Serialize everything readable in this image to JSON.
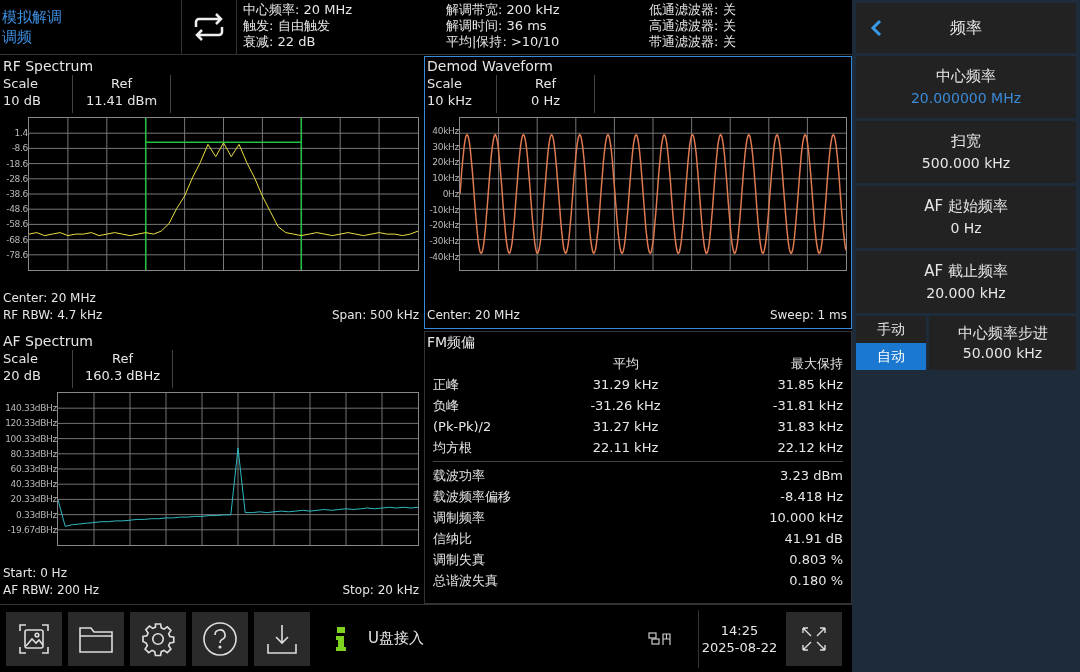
{
  "mode": {
    "title": "模拟解调",
    "subtitle": "调频"
  },
  "status": {
    "columns": [
      [
        "中心频率: 20 MHz",
        "触发: 自由触发",
        "衰减: 22 dB"
      ],
      [
        "解调带宽: 200 kHz",
        "解调时间: 36 ms",
        "平均|保持: >10/10"
      ],
      [
        "低通滤波器: 关",
        "高通滤波器: 关",
        "带通滤波器: 关"
      ]
    ]
  },
  "rf_spectrum": {
    "title": "RF Spectrum",
    "scale_label": "Scale",
    "scale": "10 dB",
    "ref_label": "Ref",
    "ref": "11.41 dBm",
    "selected": false,
    "footer_left": [
      "Center: 20 MHz",
      "RF RBW: 4.7 kHz"
    ],
    "footer_right": "Span: 500 kHz",
    "chart_data": {
      "type": "line",
      "grid": true,
      "ylim": [
        -88.6,
        11.4
      ],
      "ref_lines": [
        {
          "axis": "y",
          "value": -4.6,
          "color": "#22c040"
        }
      ],
      "yticks": [
        1.4,
        -8.6,
        -18.6,
        -28.6,
        -38.6,
        -48.6,
        -58.6,
        -68.6,
        -78.6
      ],
      "categories": [
        null,
        null,
        null,
        null,
        null,
        null,
        null,
        null,
        null,
        null,
        null,
        null,
        null,
        null,
        null,
        null,
        null,
        null,
        null,
        null,
        null,
        null,
        null,
        null,
        null,
        null,
        null,
        null,
        null,
        null,
        null,
        null,
        null,
        null,
        null,
        null,
        null,
        null,
        null,
        null,
        null,
        null,
        null,
        null,
        null,
        null,
        null,
        null,
        null,
        null,
        null
      ],
      "series": [
        {
          "color": "#e8e040",
          "values": [
            -65,
            -64,
            -66,
            -65,
            -64,
            -66,
            -65,
            -65,
            -64,
            -66,
            -65,
            -64,
            -65,
            -66,
            -65,
            -64,
            -65,
            -63,
            -58,
            -48,
            -40,
            -28,
            -18,
            -6,
            -14,
            -5,
            -14,
            -6,
            -18,
            -28,
            -40,
            -50,
            -60,
            -64,
            -65,
            -66,
            -65,
            -64,
            -65,
            -66,
            -65,
            -64,
            -65,
            -66,
            -65,
            -64,
            -65,
            -65,
            -66,
            -65,
            -63
          ]
        }
      ]
    }
  },
  "demod_waveform": {
    "title": "Demod Waveform",
    "scale_label": "Scale",
    "scale": "10 kHz",
    "ref_label": "Ref",
    "ref": "0 Hz",
    "selected": true,
    "y_labels": [
      "40kHz",
      "30kHz",
      "20kHz",
      "10kHz",
      "0Hz",
      "-10kHz",
      "-20kHz",
      "-30kHz",
      "-40kHz"
    ],
    "footer_left": [
      "Center: 20 MHz"
    ],
    "footer_right": "Sweep: 1 ms"
  },
  "af_spectrum": {
    "title": "AF Spectrum",
    "scale_label": "Scale",
    "scale": "20 dB",
    "ref_label": "Ref",
    "ref": "160.3 dBHz",
    "selected": false,
    "footer_left": [
      "Start: 0 Hz",
      "AF RBW: 200 Hz"
    ],
    "footer_right": "Stop: 20 kHz",
    "chart_data": {
      "type": "line",
      "grid": true,
      "ylim": [
        -39.67,
        160.33
      ],
      "yticks": [
        {
          "value": 140.33,
          "label": "140.33dBHz"
        },
        {
          "value": 120.33,
          "label": "120.33dBHz"
        },
        {
          "value": 100.33,
          "label": "100.33dBHz"
        },
        {
          "value": 80.33,
          "label": "80.33dBHz"
        },
        {
          "value": 60.33,
          "label": "60.33dBHz"
        },
        {
          "value": 40.33,
          "label": "40.33dBHz"
        },
        {
          "value": 20.33,
          "label": "20.33dBHz"
        },
        {
          "value": 0.33,
          "label": "0.33dBHz"
        },
        {
          "value": -19.67,
          "label": "-19.67dBHz"
        }
      ],
      "categories": [
        null,
        null,
        null,
        null,
        null,
        null,
        null,
        null,
        null,
        null,
        null,
        null,
        null,
        null,
        null,
        null,
        null,
        null,
        null,
        null,
        null,
        null,
        null,
        null,
        null,
        null,
        null,
        null,
        null,
        null,
        null,
        null,
        null,
        null,
        null,
        null,
        null,
        null,
        null,
        null,
        null,
        null,
        null,
        null,
        null,
        null,
        null,
        null,
        null,
        null,
        null
      ],
      "series": [
        {
          "color": "#30c0c8",
          "values": [
            20,
            -15,
            -13,
            -12,
            -11,
            -10,
            -9,
            -9,
            -8,
            -8,
            -7,
            -6,
            -6,
            -5,
            -5,
            -4,
            -4,
            -3,
            -3,
            -2,
            -2,
            -1,
            -1,
            0,
            0,
            88,
            3,
            3,
            4,
            3,
            4,
            5,
            4,
            5,
            6,
            5,
            6,
            7,
            6,
            7,
            8,
            7,
            8,
            9,
            8,
            9,
            10,
            9,
            10,
            9,
            10
          ]
        }
      ]
    }
  },
  "fm_deviation": {
    "title": "FM频偏",
    "headers": [
      "平均",
      "最大保持"
    ],
    "rows": [
      {
        "label": "正峰",
        "average": "31.29 kHz",
        "max_hold": "31.85 kHz"
      },
      {
        "label": "负峰",
        "average": "-31.26 kHz",
        "max_hold": "-31.81 kHz"
      },
      {
        "label": "(Pk-Pk)/2",
        "average": "31.27 kHz",
        "max_hold": "31.83 kHz"
      },
      {
        "label": "均方根",
        "average": "22.11 kHz",
        "max_hold": "22.12 kHz"
      }
    ],
    "metrics": [
      {
        "label": "载波功率",
        "value": "3.23 dBm"
      },
      {
        "label": "载波频率偏移",
        "value": "-8.418 Hz"
      },
      {
        "label": "调制频率",
        "value": "10.000 kHz"
      },
      {
        "label": "信纳比",
        "value": "41.91 dB"
      },
      {
        "label": "调制失真",
        "value": "0.803 %"
      },
      {
        "label": "总谐波失真",
        "value": "0.180 %"
      }
    ]
  },
  "menu": {
    "title": "频率",
    "items": [
      {
        "label": "中心频率",
        "value": "20.000000 MHz",
        "active": true
      },
      {
        "label": "扫宽",
        "value": "500.000 kHz",
        "active": false
      },
      {
        "label": "AF 起始频率",
        "value": "0 Hz",
        "active": false
      },
      {
        "label": "AF 截止频率",
        "value": "20.000 kHz",
        "active": false
      }
    ],
    "step": {
      "modes": [
        {
          "label": "手动",
          "selected": false
        },
        {
          "label": "自动",
          "selected": true
        }
      ],
      "label": "中心频率步进",
      "value": "50.000 kHz"
    }
  },
  "bottom_bar": {
    "message": "U盘接入",
    "time": "14:25",
    "date": "2025-08-22"
  }
}
